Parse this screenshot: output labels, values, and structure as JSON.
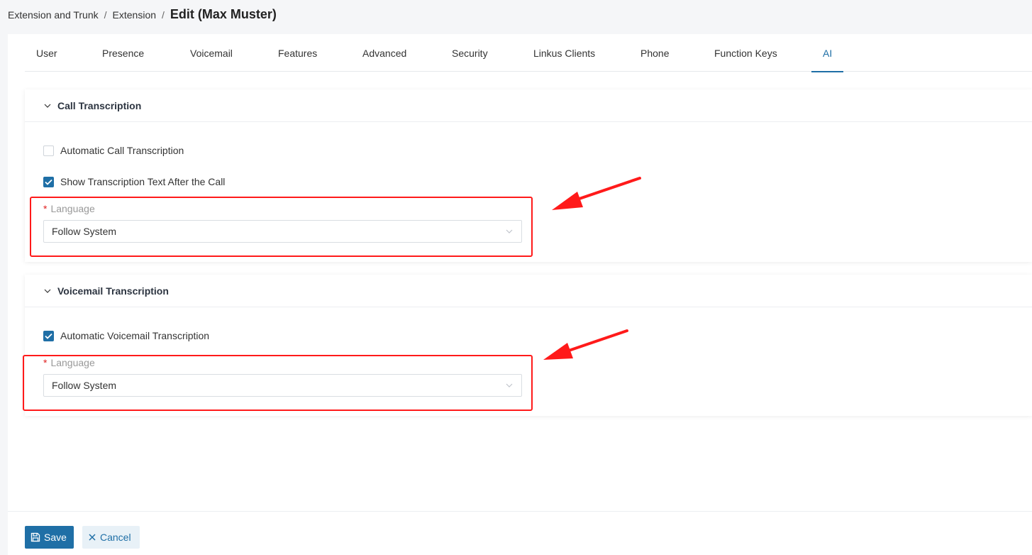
{
  "breadcrumb": {
    "item1": "Extension and Trunk",
    "separator": "/",
    "item2": "Extension",
    "title": "Edit (Max Muster)"
  },
  "tabs": [
    {
      "label": "User"
    },
    {
      "label": "Presence"
    },
    {
      "label": "Voicemail"
    },
    {
      "label": "Features"
    },
    {
      "label": "Advanced"
    },
    {
      "label": "Security"
    },
    {
      "label": "Linkus Clients"
    },
    {
      "label": "Phone"
    },
    {
      "label": "Function Keys"
    },
    {
      "label": "AI",
      "active": true
    }
  ],
  "call_transcription": {
    "title": "Call Transcription",
    "auto_label": "Automatic Call Transcription",
    "auto_checked": false,
    "show_text_label": "Show Transcription Text After the Call",
    "show_text_checked": true,
    "language_label": "Language",
    "language_required": "*",
    "language_value": "Follow System"
  },
  "voicemail_transcription": {
    "title": "Voicemail Transcription",
    "auto_label": "Automatic Voicemail Transcription",
    "auto_checked": true,
    "language_label": "Language",
    "language_required": "*",
    "language_value": "Follow System"
  },
  "footer": {
    "save_label": "Save",
    "cancel_label": "Cancel"
  },
  "colors": {
    "accent": "#1f6fa6",
    "annotation": "#ff1a1a",
    "required": "#e02020"
  }
}
